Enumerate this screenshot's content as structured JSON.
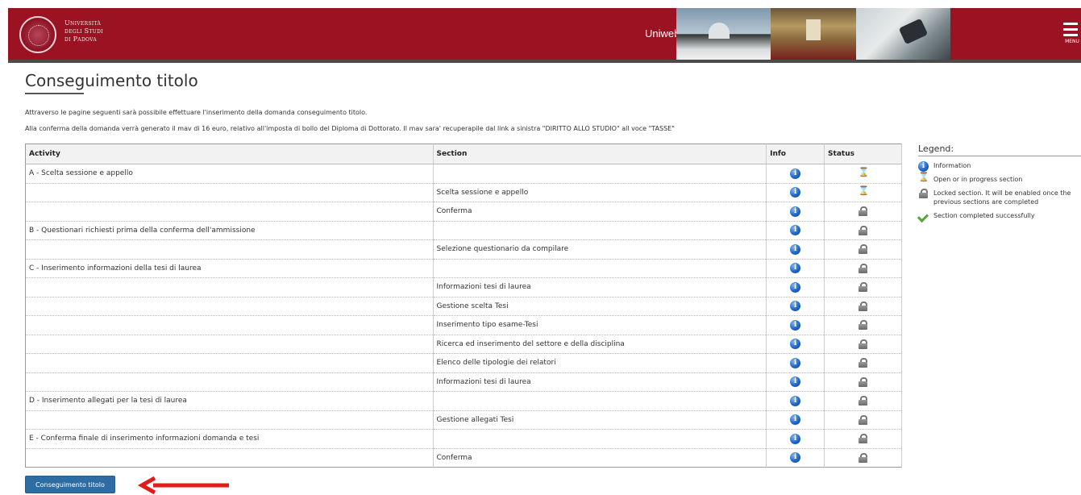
{
  "header": {
    "university_name_lines": [
      "Università",
      "degli Studi",
      "di Padova"
    ],
    "app_name": "Uniweb",
    "menu_label": "MENU"
  },
  "page": {
    "title": "Conseguimento titolo",
    "intro_1": "Attraverso le pagine seguenti sarà possibile effettuare l'inserimento della domanda conseguimento titolo.",
    "intro_2": "Alla conferma della domanda verrà generato il mav di 16 euro, relativo all'imposta di bollo del Diploma di Dottorato. Il mav sara' recuperapile dal link a sinistra \"DIRITTO ALLO STUDIO\" all voce \"TASSE\""
  },
  "table": {
    "headers": {
      "activity": "Activity",
      "section": "Section",
      "info": "Info",
      "status": "Status"
    },
    "rows": [
      {
        "activity": "A - Scelta sessione e appello",
        "section": "",
        "status": "open"
      },
      {
        "activity": "",
        "section": "Scelta sessione e appello",
        "status": "open"
      },
      {
        "activity": "",
        "section": "Conferma",
        "status": "locked"
      },
      {
        "activity": "B - Questionari richiesti prima della conferma dell'ammissione",
        "section": "",
        "status": "locked"
      },
      {
        "activity": "",
        "section": "Selezione questionario da compilare",
        "status": "locked"
      },
      {
        "activity": "C - Inserimento informazioni della tesi di laurea",
        "section": "",
        "status": "locked"
      },
      {
        "activity": "",
        "section": "Informazioni tesi di laurea",
        "status": "locked"
      },
      {
        "activity": "",
        "section": "Gestione scelta Tesi",
        "status": "locked"
      },
      {
        "activity": "",
        "section": "Inserimento tipo esame-Tesi",
        "status": "locked"
      },
      {
        "activity": "",
        "section": "Ricerca ed inserimento del settore e della disciplina",
        "status": "locked"
      },
      {
        "activity": "",
        "section": "Elenco delle tipologie dei relatori",
        "status": "locked"
      },
      {
        "activity": "",
        "section": "Informazioni tesi di laurea",
        "status": "locked"
      },
      {
        "activity": "D - Inserimento allegati per la tesi di laurea",
        "section": "",
        "status": "locked"
      },
      {
        "activity": "",
        "section": "Gestione allegati Tesi",
        "status": "locked"
      },
      {
        "activity": "E - Conferma finale di inserimento informazioni domanda e tesi",
        "section": "",
        "status": "locked"
      },
      {
        "activity": "",
        "section": "Conferma",
        "status": "locked"
      }
    ]
  },
  "legend": {
    "title": "Legend:",
    "information": "Information",
    "open": "Open or in progress section",
    "locked": "Locked section. It will be enabled once the previous sections are completed",
    "completed": "Section completed successfully"
  },
  "actions": {
    "submit_label": "Conseguimento titolo"
  },
  "colors": {
    "header_bg": "#9b1223",
    "button_bg": "#2e6da4",
    "arrow": "#e31b1b"
  }
}
